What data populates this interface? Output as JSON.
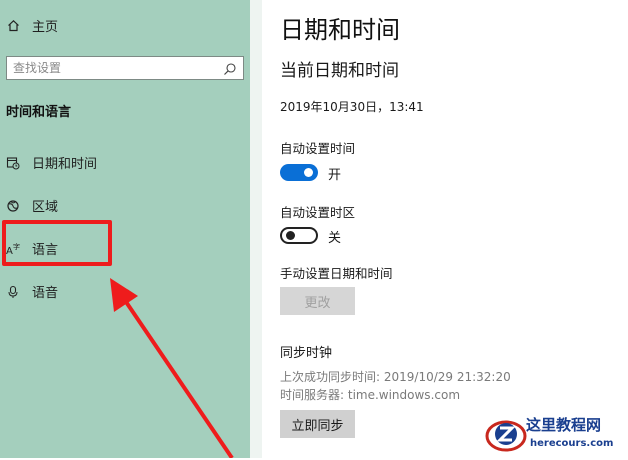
{
  "sidebar": {
    "home_label": "主页",
    "search_placeholder": "查找设置",
    "section_title": "时间和语言",
    "items": [
      {
        "label": "日期和时间",
        "icon": "calendar-clock-icon"
      },
      {
        "label": "区域",
        "icon": "globe-icon"
      },
      {
        "label": "语言",
        "icon": "language-icon"
      },
      {
        "label": "语音",
        "icon": "microphone-icon"
      }
    ]
  },
  "main": {
    "title": "日期和时间",
    "subtitle": "当前日期和时间",
    "current_datetime": "2019年10月30日，13:41",
    "auto_time": {
      "label": "自动设置时间",
      "state": "开",
      "on": true
    },
    "auto_timezone": {
      "label": "自动设置时区",
      "state": "关",
      "on": false
    },
    "manual": {
      "label": "手动设置日期和时间",
      "button": "更改"
    },
    "sync": {
      "title": "同步时钟",
      "last_sync": "上次成功同步时间: 2019/10/29 21:32:20",
      "server": "时间服务器: time.windows.com",
      "button": "立即同步"
    }
  },
  "watermark": {
    "title": "这里教程网",
    "url": "herecours.com"
  },
  "colors": {
    "sidebar": "#a4cfbd",
    "accent": "#0a6fd6",
    "highlight": "#ee1c1c"
  }
}
